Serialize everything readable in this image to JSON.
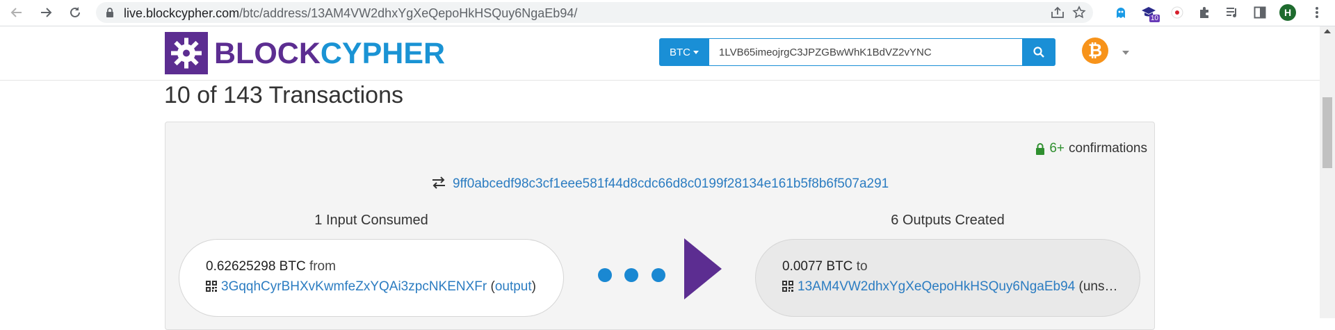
{
  "browser": {
    "url_host": "live.blockcypher.com",
    "url_path": "/btc/address/13AM4VW2dhxYgXeQepoHkHSQuy6NgaEb94/",
    "extension_badge": "10",
    "profile_initial": "H"
  },
  "header": {
    "logo_part1": "BLOCK",
    "logo_part2": "CYPHER",
    "coin_selector": "BTC",
    "search_value": "1LVB65imeojrgC3JPZGBwWhK1BdVZ2vYNC",
    "coin_icon": "₿"
  },
  "content": {
    "heading": "10 of 143 Transactions",
    "transaction": {
      "confirmations_count": "6+",
      "confirmations_label": "confirmations",
      "hash": "9ff0abcedf98c3cf1eee581f44d8cdc66d8c0199f28134e161b5f8b6f507a291",
      "inputs_title": "1 Input Consumed",
      "outputs_title": "6 Outputs Created",
      "input": {
        "amount": "0.62625298 BTC",
        "from_label": "from",
        "address": "3GqqhCyrBHXvKwmfeZxYQAi3zpcNKENXFr",
        "output_link": "output"
      },
      "output": {
        "amount": "0.0077 BTC",
        "to_label": "to",
        "address": "13AM4VW2dhxYgXeQepoHkHSQuy6NgaEb94",
        "status": "(uns…"
      }
    }
  },
  "colors": {
    "brand_purple": "#5c2d91",
    "brand_blue": "#1a93d4",
    "link_blue": "#2b7cc1",
    "bitcoin_orange": "#f7931a"
  }
}
